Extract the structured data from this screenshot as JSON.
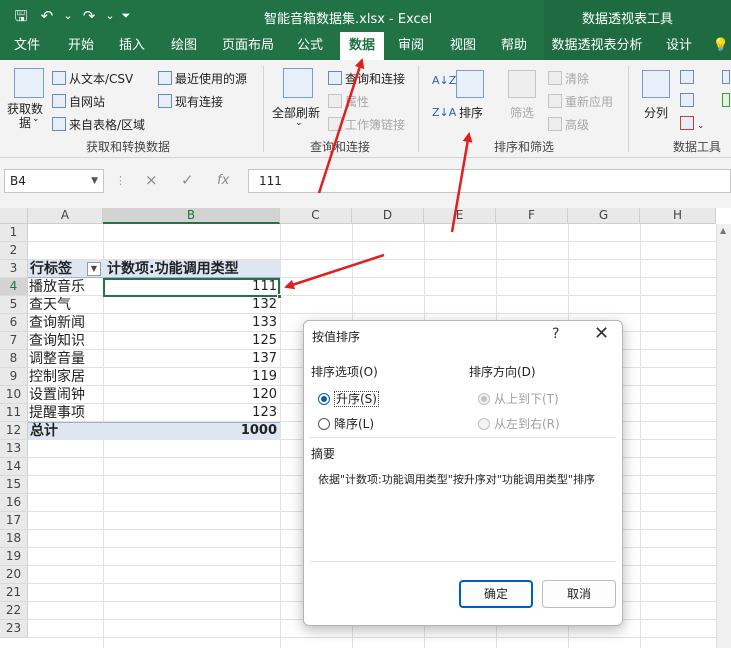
{
  "titlebar": {
    "doc_title": "智能音箱数据集.xlsx  -  Excel",
    "context_title": "数据透视表工具",
    "icons": [
      "save-icon",
      "undo-icon",
      "redo-icon",
      "customize-qat-icon"
    ]
  },
  "tabs": [
    "文件",
    "开始",
    "插入",
    "绘图",
    "页面布局",
    "公式",
    "数据",
    "审阅",
    "视图",
    "帮助",
    "数据透视表分析",
    "设计"
  ],
  "active_tab": "数据",
  "ribbon": {
    "get_data": {
      "label": "获取数\n据",
      "chevron": "⌄"
    },
    "from_text_csv": "从文本/CSV",
    "from_web": "自网站",
    "from_table": "来自表格/区域",
    "recent_sources": "最近使用的源",
    "existing_connections": "现有连接",
    "group_get_transform": "获取和转换数据",
    "refresh_all": "全部刷新",
    "queries_connections": "查询和连接",
    "properties": "属性",
    "edit_links": "工作簿链接",
    "group_queries": "查询和连接",
    "sort": "排序",
    "filter": "筛选",
    "clear": "清除",
    "reapply": "重新应用",
    "advanced": "高级",
    "group_sort_filter": "排序和筛选",
    "split": "分列",
    "group_data_tools": "数据工具"
  },
  "formula_bar": {
    "name_box": "B4",
    "value": "111",
    "cancel": "×",
    "confirm": "✓",
    "fx": "fx"
  },
  "columns": [
    "A",
    "B",
    "C",
    "D",
    "E",
    "F",
    "G",
    "H"
  ],
  "rows": [
    "1",
    "2",
    "3",
    "4",
    "5",
    "6",
    "7",
    "8",
    "9",
    "10",
    "11",
    "12",
    "13",
    "14",
    "15",
    "16",
    "17",
    "18",
    "19",
    "20",
    "21",
    "22",
    "23"
  ],
  "pivot": {
    "row_label_header": "行标签",
    "value_header": "计数项:功能调用类型",
    "items": [
      {
        "label": "播放音乐",
        "value": "111"
      },
      {
        "label": "查天气",
        "value": "132"
      },
      {
        "label": "查询新闻",
        "value": "133"
      },
      {
        "label": "查询知识",
        "value": "125"
      },
      {
        "label": "调整音量",
        "value": "137"
      },
      {
        "label": "控制家居",
        "value": "119"
      },
      {
        "label": "设置闹钟",
        "value": "120"
      },
      {
        "label": "提醒事项",
        "value": "123"
      }
    ],
    "total_label": "总计",
    "total_value": "1000"
  },
  "dialog": {
    "title": "按值排序",
    "help": "?",
    "close": "✕",
    "sort_options_label": "排序选项(O)",
    "ascending": "升序(S)",
    "descending": "降序(L)",
    "direction_label": "排序方向(D)",
    "top_to_bottom": "从上到下(T)",
    "left_to_right": "从左到右(R)",
    "summary_label": "摘要",
    "summary_text": "依据\"计数项:功能调用类型\"按升序对\"功能调用类型\"排序",
    "ok": "确定",
    "cancel": "取消"
  },
  "colors": {
    "excel_green": "#217346",
    "annotation_red": "#e02020",
    "dialog_blue": "#005fb8",
    "pivot_band": "#dde6f1"
  }
}
